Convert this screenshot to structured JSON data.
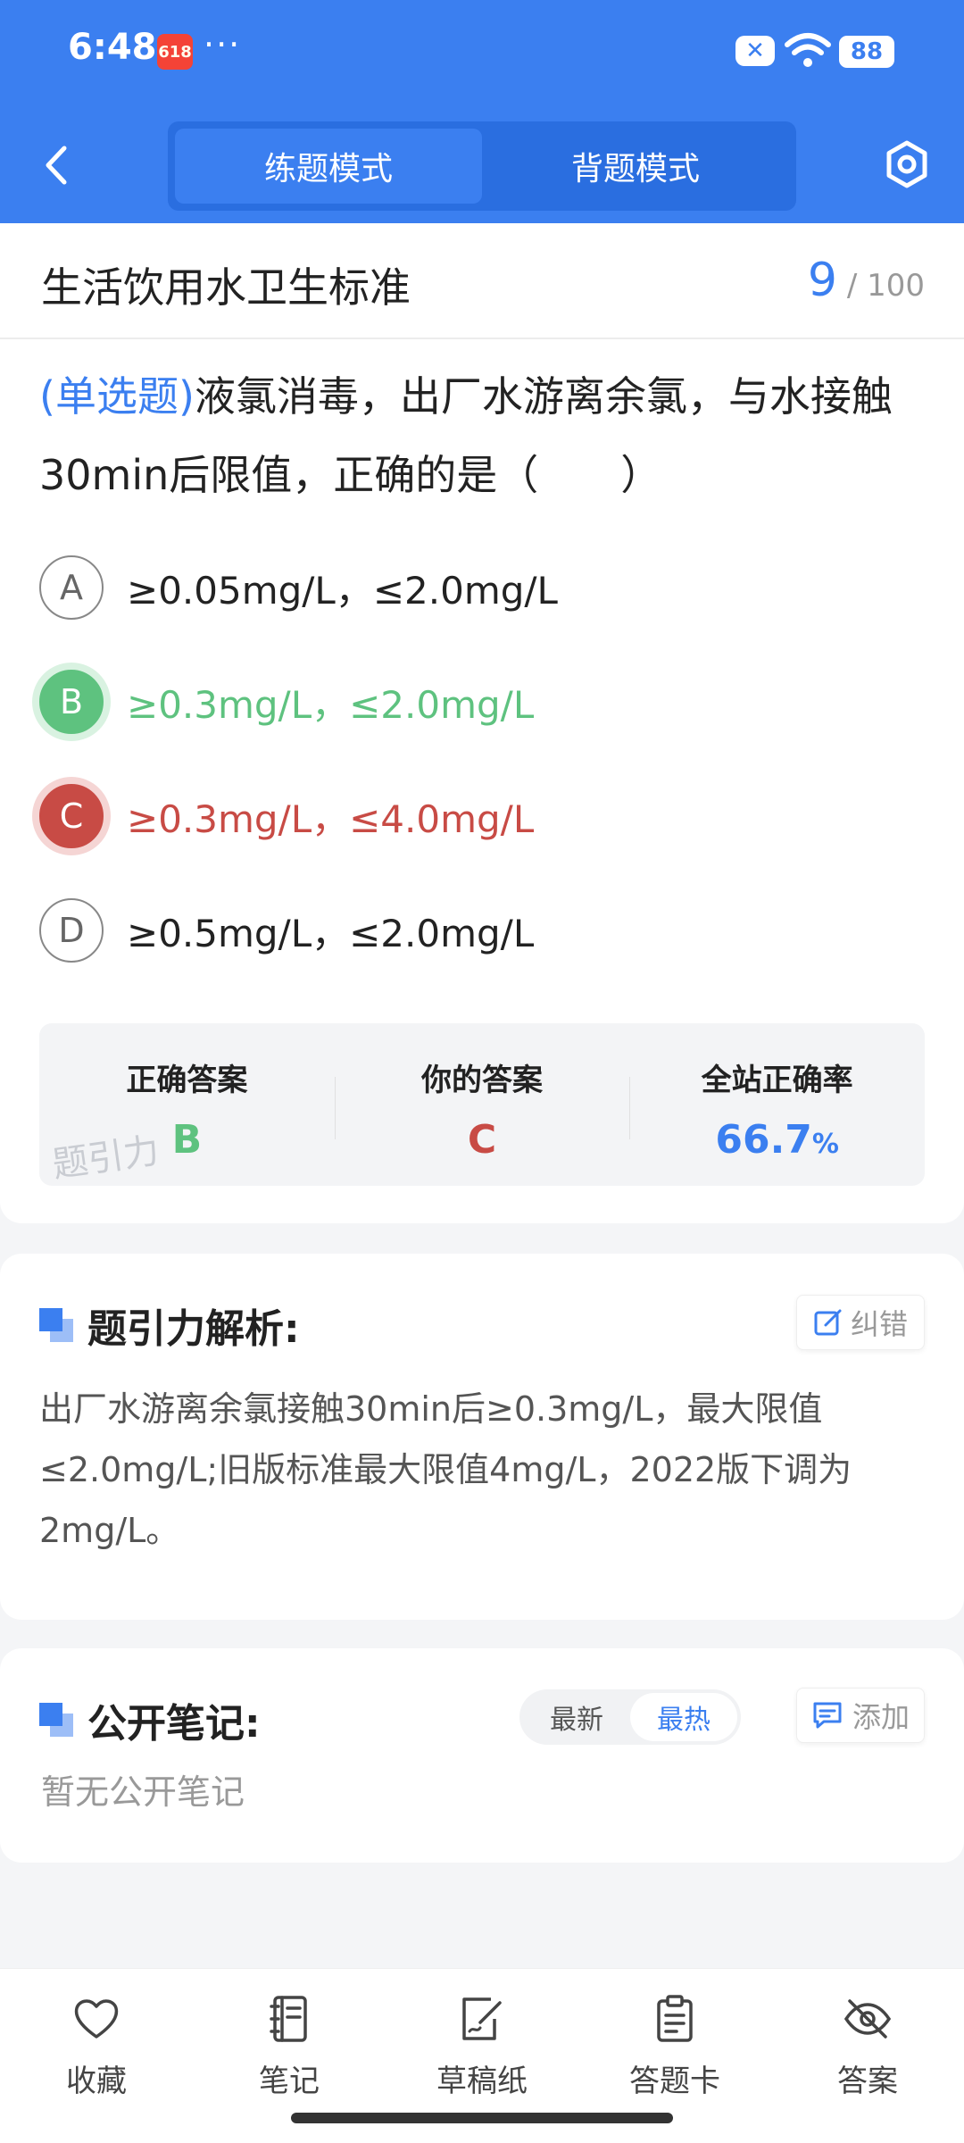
{
  "status": {
    "time": "6:48",
    "more": "···",
    "battery": "88",
    "app_badge": "618"
  },
  "header": {
    "tabs": [
      "练题模式",
      "背题模式"
    ],
    "active_tab": 0
  },
  "subject": {
    "title": "生活饮用水卫生标准",
    "current": "9",
    "total": "/ 100"
  },
  "question": {
    "type": "(单选题)",
    "text": "液氯消毒，出厂水游离余氯，与水接触30min后限值，正确的是（　　）"
  },
  "options": [
    {
      "letter": "A",
      "text": "≥0.05mg/L，≤2.0mg/L",
      "state": "normal"
    },
    {
      "letter": "B",
      "text": "≥0.3mg/L，≤2.0mg/L",
      "state": "correct"
    },
    {
      "letter": "C",
      "text": "≥0.3mg/L，≤4.0mg/L",
      "state": "wrong"
    },
    {
      "letter": "D",
      "text": "≥0.5mg/L，≤2.0mg/L",
      "state": "normal"
    }
  ],
  "result": {
    "correct_label": "正确答案",
    "correct_value": "B",
    "yours_label": "你的答案",
    "yours_value": "C",
    "rate_label": "全站正确率",
    "rate_value": "66.7",
    "rate_unit": "%",
    "watermark": "题引力"
  },
  "analysis": {
    "title": "题引力解析:",
    "correct_button": "纠错",
    "text": "出厂水游离余氯接触30min后≥0.3mg/L，最大限值≤2.0mg/L;旧版标准最大限值4mg/L，2022版下调为2mg/L。"
  },
  "notes": {
    "title": "公开笔记:",
    "sort_tabs": [
      "最新",
      "最热"
    ],
    "active_sort": 1,
    "add_button": "添加",
    "empty": "暂无公开笔记"
  },
  "bottom_bar": [
    {
      "label": "收藏",
      "icon": "heart-icon"
    },
    {
      "label": "笔记",
      "icon": "notebook-icon"
    },
    {
      "label": "草稿纸",
      "icon": "draft-icon"
    },
    {
      "label": "答题卡",
      "icon": "answer-card-icon"
    },
    {
      "label": "答案",
      "icon": "eye-off-icon"
    }
  ],
  "colors": {
    "primary": "#3b7ff0",
    "correct": "#5ec27f",
    "wrong": "#c84b45"
  }
}
